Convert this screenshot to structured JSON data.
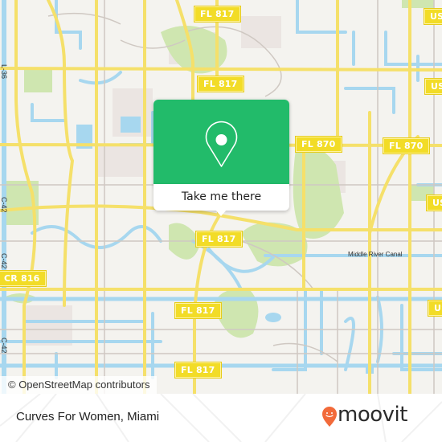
{
  "map": {
    "attribution": "© OpenStreetMap contributors",
    "popup": {
      "button_label": "Take me there",
      "icon": "map-pin-icon",
      "color": "#22bb6a"
    },
    "road_shields": [
      {
        "label": "FL 817"
      },
      {
        "label": "FL 817"
      },
      {
        "label": "FL 870"
      },
      {
        "label": "FL 870"
      },
      {
        "label": "FL 817"
      },
      {
        "label": "CR 816"
      },
      {
        "label": "FL 817"
      },
      {
        "label": "FL 817"
      },
      {
        "label": "US"
      },
      {
        "label": "US"
      },
      {
        "label": "US"
      },
      {
        "label": "US"
      }
    ],
    "water_labels": {
      "canal": "Middle River Canal",
      "l36": "L-36",
      "c42a": "C-42",
      "c42b": "C-42",
      "c42c": "C-42"
    },
    "colors": {
      "land": "#f4f3ef",
      "water": "#a7d7ef",
      "park": "#cfe6b0",
      "road_major": "#f5e06a",
      "shield": "#f2dc27"
    }
  },
  "footer": {
    "place_name": "Curves For Women, Miami",
    "brand": "moovit",
    "brand_color": "#f26a3a"
  }
}
